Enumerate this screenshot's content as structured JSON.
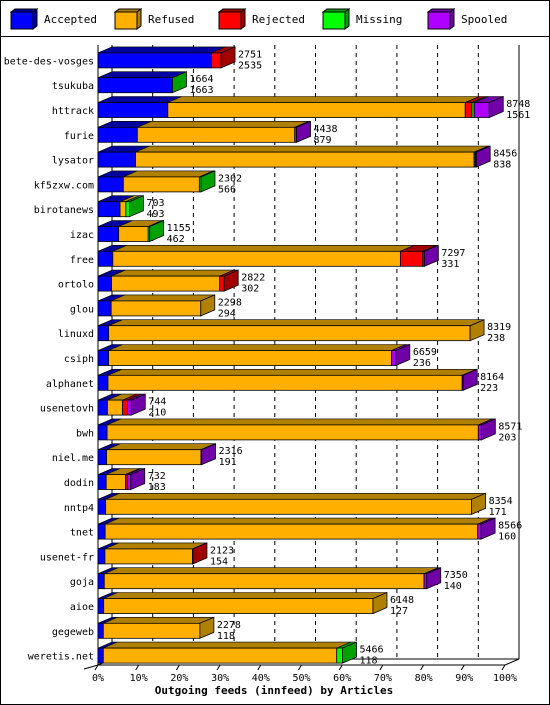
{
  "chart_data": {
    "type": "bar",
    "orientation": "horizontal",
    "stacked": true,
    "three_d": true,
    "title": "",
    "xlabel": "Outgoing feeds (innfeed) by Articles",
    "ylabel": "",
    "xlim_percent": [
      0,
      100
    ],
    "x_ticks": [
      "0%",
      "10%",
      "20%",
      "30%",
      "40%",
      "50%",
      "60%",
      "70%",
      "80%",
      "90%",
      "100%"
    ],
    "grid": "vertical dashed",
    "legend_position": "top",
    "legend": [
      {
        "name": "Accepted",
        "color": "#0000ff",
        "side": "#00009f"
      },
      {
        "name": "Refused",
        "color": "#ffaf00",
        "side": "#b08000"
      },
      {
        "name": "Rejected",
        "color": "#ff0000",
        "side": "#a00000"
      },
      {
        "name": "Missing",
        "color": "#00ff00",
        "side": "#00a000"
      },
      {
        "name": "Spooled",
        "color": "#af00ff",
        "side": "#7000a8"
      }
    ],
    "axis_max_articles": 9100,
    "categories": [
      "bete-des-vosges",
      "tsukuba",
      "httrack",
      "furie",
      "lysator",
      "kf5zxw.com",
      "birotanews",
      "izac",
      "free",
      "ortolo",
      "glou",
      "linuxd",
      "csiph",
      "alphanet",
      "usenetovh",
      "bwh",
      "niel.me",
      "dodin",
      "nntp4",
      "tnet",
      "usenet-fr",
      "goja",
      "aioe",
      "gegeweb",
      "weretis.net"
    ],
    "totals": [
      2751,
      1664,
      8748,
      4438,
      8456,
      2302,
      703,
      1155,
      7297,
      2822,
      2298,
      8319,
      6659,
      8164,
      744,
      8571,
      2316,
      732,
      8354,
      8566,
      2123,
      7350,
      6148,
      2278,
      5466
    ],
    "accepted": [
      2535,
      1663,
      1561,
      879,
      838,
      566,
      493,
      462,
      331,
      302,
      294,
      238,
      236,
      223,
      210,
      203,
      191,
      183,
      171,
      160,
      154,
      140,
      127,
      118,
      118
    ],
    "series": [
      {
        "name": "Accepted",
        "values": [
          2535,
          1663,
          1561,
          879,
          838,
          566,
          493,
          462,
          331,
          302,
          294,
          238,
          236,
          223,
          210,
          203,
          191,
          183,
          171,
          160,
          154,
          140,
          127,
          118,
          118
        ]
      },
      {
        "name": "Refused",
        "values": [
          0,
          0,
          6650,
          3520,
          7570,
          1700,
          130,
          660,
          6430,
          2420,
          2004,
          8081,
          6330,
          7920,
          340,
          8300,
          2110,
          430,
          8183,
          8330,
          1960,
          7150,
          6021,
          2160,
          5220
        ]
      },
      {
        "name": "Rejected",
        "values": [
          216,
          0,
          150,
          0,
          0,
          0,
          0,
          0,
          500,
          100,
          0,
          0,
          0,
          0,
          110,
          0,
          0,
          40,
          0,
          0,
          9,
          0,
          0,
          0,
          0
        ]
      },
      {
        "name": "Missing",
        "values": [
          0,
          1,
          50,
          0,
          25,
          36,
          80,
          33,
          25,
          0,
          0,
          0,
          0,
          0,
          0,
          0,
          0,
          0,
          0,
          0,
          0,
          0,
          0,
          0,
          128
        ]
      },
      {
        "name": "Spooled",
        "values": [
          0,
          0,
          337,
          39,
          23,
          0,
          0,
          0,
          11,
          0,
          0,
          0,
          93,
          21,
          84,
          68,
          15,
          79,
          0,
          76,
          0,
          60,
          0,
          0,
          0
        ]
      }
    ]
  }
}
